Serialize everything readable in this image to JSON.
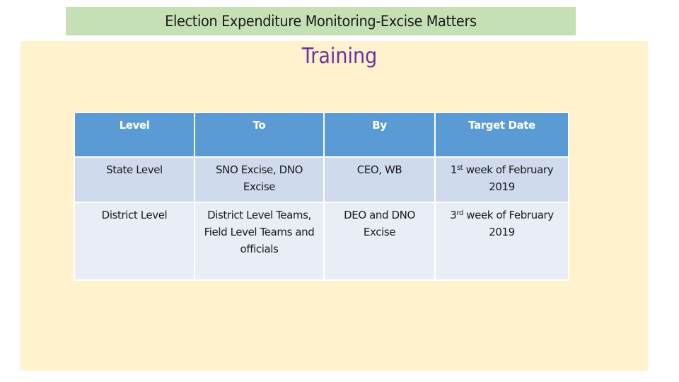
{
  "slide": {
    "title": "Election Expenditure Monitoring-Excise Matters",
    "heading": "Training",
    "colors": {
      "title_bar_bg": "#c5e0b4",
      "content_bg": "#fff2cc",
      "heading_color": "#7030a0",
      "table_header_bg": "#5b9bd5",
      "row_1_bg": "#cfdaec",
      "row_2_bg": "#e8edf6"
    }
  },
  "table": {
    "headers": [
      "Level",
      "To",
      "By",
      "Target Date"
    ],
    "rows": [
      {
        "level": "State Level",
        "to": "SNO Excise, DNO Excise",
        "by": "CEO, WB",
        "target_date": {
          "num": "1",
          "suffix": "st",
          "text": " week of February 2019"
        }
      },
      {
        "level": "District Level",
        "to": "District Level Teams, Field Level Teams and officials",
        "by": "DEO and DNO Excise",
        "target_date": {
          "num": "3",
          "suffix": "rd",
          "text": " week of February 2019"
        }
      }
    ]
  }
}
